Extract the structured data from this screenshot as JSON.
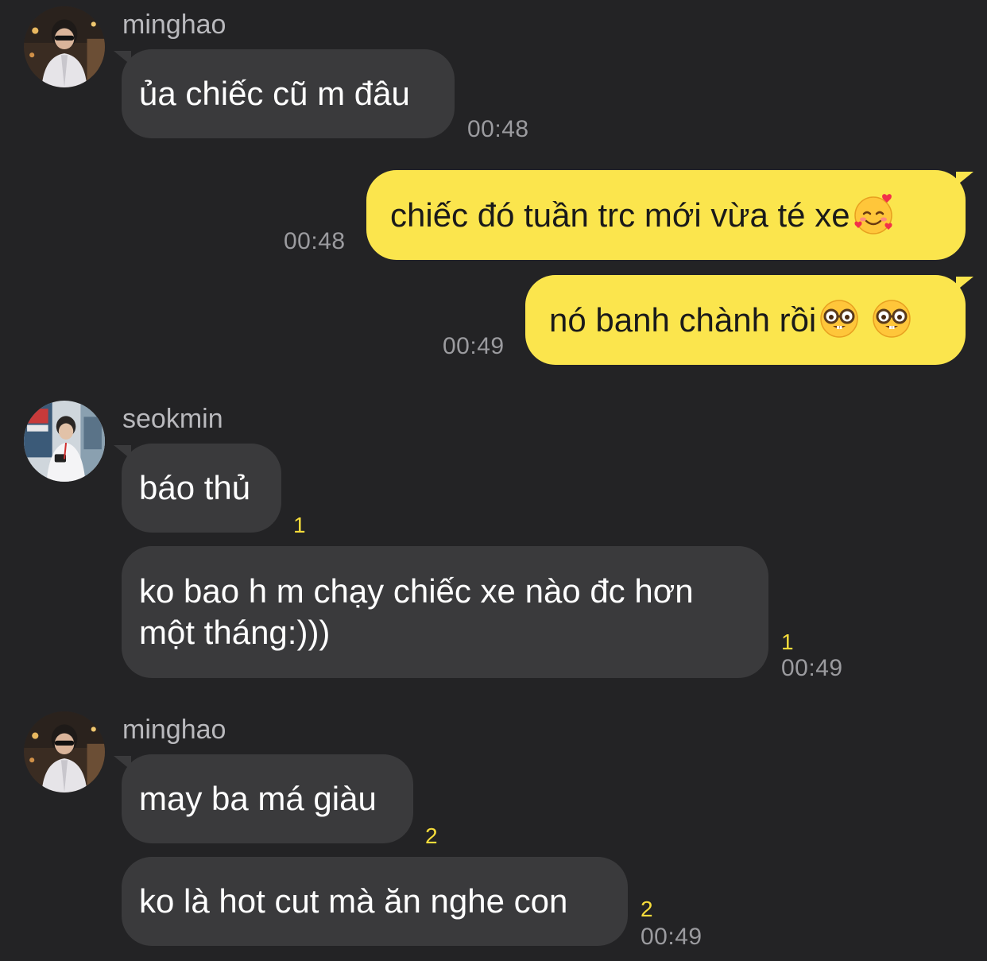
{
  "colors": {
    "background": "#232325",
    "incoming_bubble": "#3a3a3c",
    "outgoing_bubble": "#fbe54d",
    "unread_count": "#f6dc3b",
    "timestamp": "#9b9b9f"
  },
  "messages": [
    {
      "sender": "minghao",
      "text": "ủa chiếc cũ m đâu",
      "time": "00:48"
    },
    {
      "text": "chiếc đó tuần trc mới vừa té xe",
      "emoji": "smiling-face-with-hearts",
      "time": "00:48"
    },
    {
      "text": "nó banh chành rồi",
      "emoji": "nerd-face",
      "time": "00:49"
    },
    {
      "sender": "seokmin",
      "text": "báo thủ",
      "unread": "1"
    },
    {
      "text_line1": "ko bao h m chạy chiếc xe nào đc hơn",
      "text_line2": "một tháng:)))",
      "unread": "1",
      "time": "00:49"
    },
    {
      "sender": "minghao",
      "text": "may ba má giàu",
      "unread": "2"
    },
    {
      "text": "ko là hot cut mà ăn nghe con",
      "unread": "2",
      "time": "00:49"
    }
  ]
}
